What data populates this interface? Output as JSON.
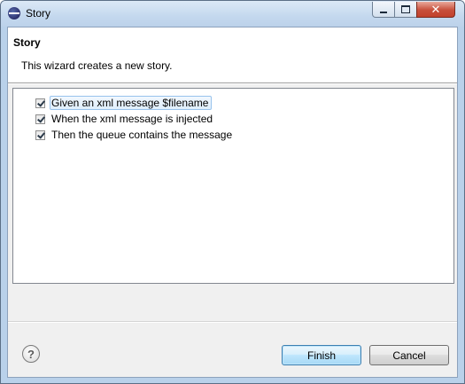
{
  "window": {
    "title": "Story",
    "buttons": {
      "minimize": "minimize-icon",
      "maximize": "maximize-icon",
      "close": "close-icon"
    }
  },
  "banner": {
    "title": "Story",
    "description": "This wizard creates a new story."
  },
  "steps": [
    {
      "label": "Given an xml message $filename",
      "checked": true,
      "selected": true
    },
    {
      "label": "When the xml message is injected",
      "checked": true,
      "selected": false
    },
    {
      "label": "Then the queue contains the message",
      "checked": true,
      "selected": false
    }
  ],
  "footer": {
    "help_glyph": "?",
    "finish_label": "Finish",
    "cancel_label": "Cancel"
  },
  "colors": {
    "accent": "#3c7fb1",
    "close": "#c74f3b",
    "selection": "#dfeefc"
  }
}
